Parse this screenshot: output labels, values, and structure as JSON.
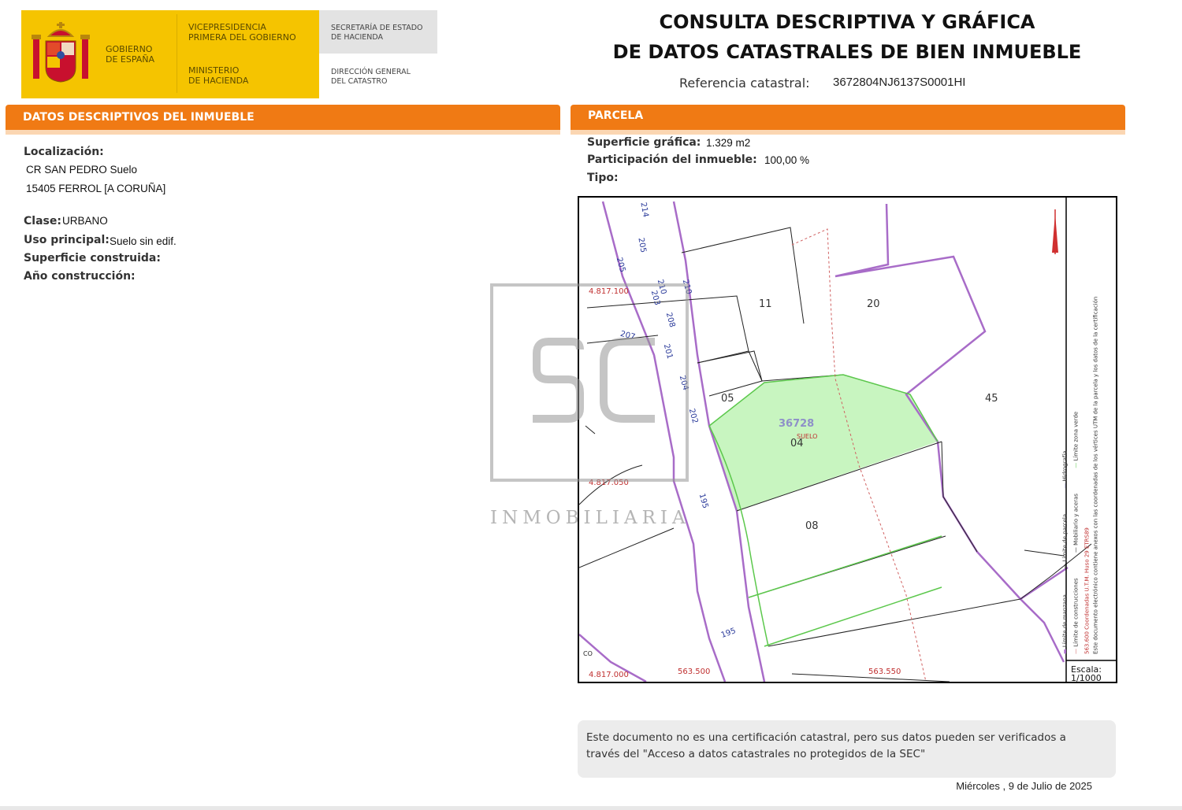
{
  "header": {
    "gov_name": [
      "GOBIERNO",
      "DE ESPAÑA"
    ],
    "vice_presidency": [
      "VICEPRESIDENCIA",
      "PRIMERA DEL GOBIERNO"
    ],
    "ministry": [
      "MINISTERIO",
      "DE HACIENDA"
    ],
    "secretary": [
      "SECRETARÍA DE ESTADO",
      "DE HACIENDA"
    ],
    "directorate": [
      "DIRECCIÓN GENERAL",
      "DEL CATASTRO"
    ],
    "title_line1": "CONSULTA DESCRIPTIVA Y GRÁFICA",
    "title_line2": "DE DATOS CATASTRALES DE BIEN INMUEBLE",
    "ref_label": "Referencia catastral:",
    "ref_value": "3672804NJ6137S0001HI"
  },
  "descriptive": {
    "section_title": "DATOS DESCRIPTIVOS DEL INMUEBLE",
    "localizacion_label": "Localización:",
    "address_line1": "CR SAN PEDRO  Suelo",
    "address_line2": "15405 FERROL [A CORUÑA]",
    "clase_label": "Clase:",
    "clase_value": "URBANO",
    "uso_label": "Uso principal:",
    "uso_value": "Suelo sin edif.",
    "sup_construida_label": "Superficie construida:",
    "anio_label": "Año construcción:"
  },
  "parcela": {
    "section_title": "PARCELA",
    "sup_grafica_label": "Superficie gráfica:",
    "sup_grafica_value": "1.329 m2",
    "participacion_label": "Participación del inmueble:",
    "participacion_value": "100,00 %",
    "tipo_label": "Tipo:"
  },
  "map": {
    "parcel_ref": "36728",
    "parcel_use": "SUELO",
    "parcel_numbers": [
      "11",
      "20",
      "05",
      "04",
      "45",
      "08"
    ],
    "street_numbers": [
      "214",
      "205",
      "205",
      "210",
      "210",
      "203",
      "208",
      "207",
      "201",
      "204",
      "202",
      "195",
      "195",
      "CO"
    ],
    "coord_labels": [
      "4.817.100",
      "4.817.050",
      "4.817.000",
      "563.500",
      "563.550"
    ],
    "legend": {
      "col1": [
        "Límite de manzana",
        "Límite de parcela",
        "Hidrografía"
      ],
      "col2": [
        "Límite de construcciones",
        "Mobiliario y aceras",
        "Límite zona verde"
      ],
      "col3": "Este documento electrónico contiene anexos con las coordenadas de los vértices UTM de la parcela y los datos de la certificación",
      "coords_note": "563.600 Coordenadas U.T.M. Huso 29 ETRS89"
    },
    "scale_label": "Escala:",
    "scale_value": "1/1000"
  },
  "watermark": {
    "monogram": "SC",
    "text": "INMOBILIARIA"
  },
  "footer": {
    "notice": "Este documento no es una certificación catastral, pero sus datos pueden ser verificados a través del \"Acceso a datos catastrales no protegidos de la SEC\"",
    "date": "Miércoles , 9 de Julio de 2025"
  },
  "colors": {
    "orange": "#f07a14",
    "yellow": "#f5c400",
    "parcel_fill": "#c8f5c0",
    "boundary": "#a86cc8",
    "green_line": "#5cc84c"
  }
}
